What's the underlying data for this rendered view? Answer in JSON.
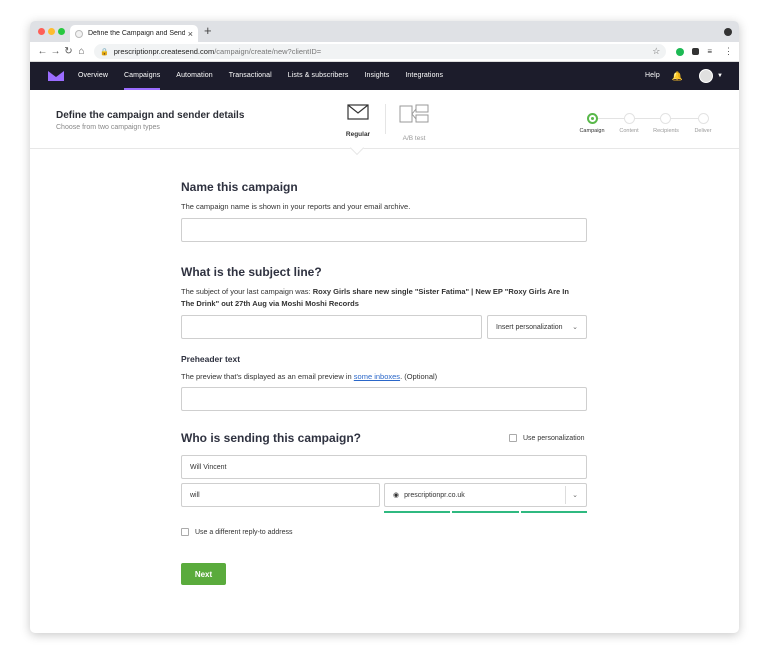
{
  "browser": {
    "tab_title": "Define the Campaign and Send",
    "tab_close": "×",
    "new_tab": "+",
    "url_domain": "prescriptionpr.createsend.com",
    "url_path": "/campaign/create/new?clientID="
  },
  "nav": {
    "items": [
      "Overview",
      "Campaigns",
      "Automation",
      "Transactional",
      "Lists & subscribers",
      "Insights",
      "Integrations"
    ],
    "active": "Campaigns",
    "help": "Help"
  },
  "header": {
    "title": "Define the campaign and sender details",
    "subtitle": "Choose from two campaign types",
    "types": [
      {
        "label": "Regular",
        "icon": "envelope-icon"
      },
      {
        "label": "A/B test",
        "icon": "ab-test-icon"
      }
    ],
    "steps": [
      "Campaign",
      "Content",
      "Recipients",
      "Deliver"
    ],
    "active_step": "Campaign"
  },
  "name_section": {
    "heading": "Name this campaign",
    "description": "The campaign name is shown in your reports and your email archive.",
    "value": ""
  },
  "subject_section": {
    "heading": "What is the subject line?",
    "description_prefix": "The subject of your last campaign was:",
    "last_subject": "Roxy Girls share new single \"Sister Fatima\" | New EP \"Roxy Girls Are In The Drink\" out 27th Aug via Moshi Moshi Records",
    "value": "",
    "personalization_label": "Insert personalization"
  },
  "preheader_section": {
    "heading": "Preheader text",
    "description_prefix": "The preview that's displayed as an email preview in",
    "link_text": "some inboxes",
    "description_suffix": ". (Optional)",
    "value": ""
  },
  "sender_section": {
    "heading": "Who is sending this campaign?",
    "use_personalization_label": "Use personalization",
    "from_name": "Will Vincent",
    "email_local": "will",
    "email_domain": "prescriptionpr.co.uk",
    "reply_to_label": "Use a different reply-to address"
  },
  "next_button": "Next",
  "colors": {
    "nav_bg": "#1c1c2b",
    "nav_active": "#9b6dff",
    "primary_button": "#5aab3c",
    "validation": "#2fb980",
    "link": "#2a67c9"
  }
}
